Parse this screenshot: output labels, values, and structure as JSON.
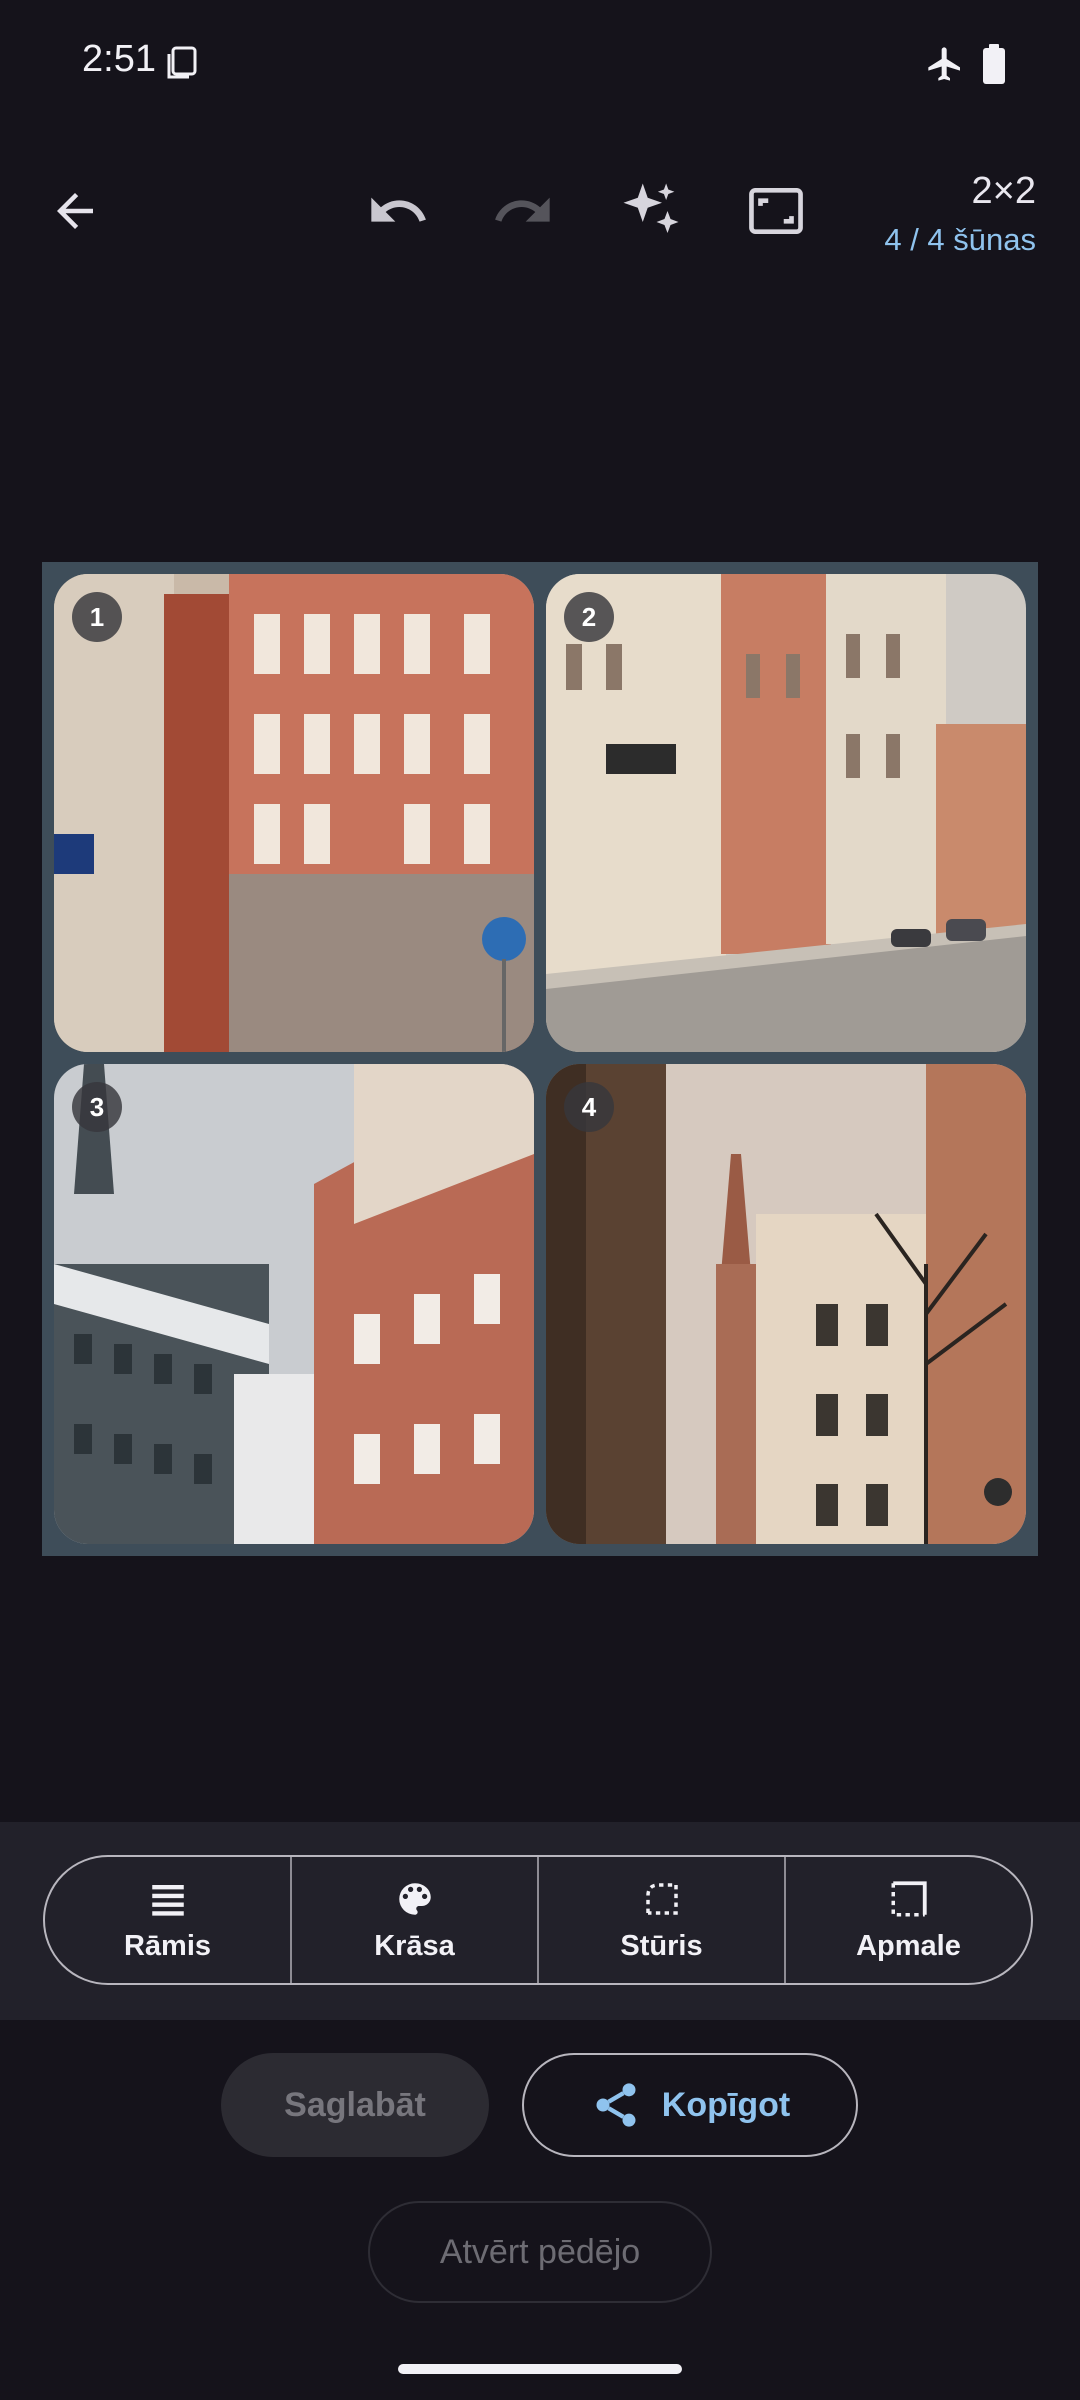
{
  "status_bar": {
    "time": "2:51"
  },
  "toolbar": {
    "grid_size": "2×2",
    "cell_count": "4 / 4 šūnas"
  },
  "collage": {
    "tiles": [
      {
        "number": "1"
      },
      {
        "number": "2"
      },
      {
        "number": "3"
      },
      {
        "number": "4"
      }
    ]
  },
  "options": {
    "items": [
      {
        "label": "Rāmis",
        "icon": "frame-lines-icon"
      },
      {
        "label": "Krāsa",
        "icon": "palette-icon"
      },
      {
        "label": "Stūris",
        "icon": "corner-icon"
      },
      {
        "label": "Apmale",
        "icon": "border-icon"
      }
    ]
  },
  "actions": {
    "save_label": "Saglabāt",
    "share_label": "Kopīgot",
    "open_last_label": "Atvērt pēdējo"
  },
  "colors": {
    "accent": "#8fc3ee",
    "background": "#15131b",
    "frame": "#3e4d59"
  }
}
